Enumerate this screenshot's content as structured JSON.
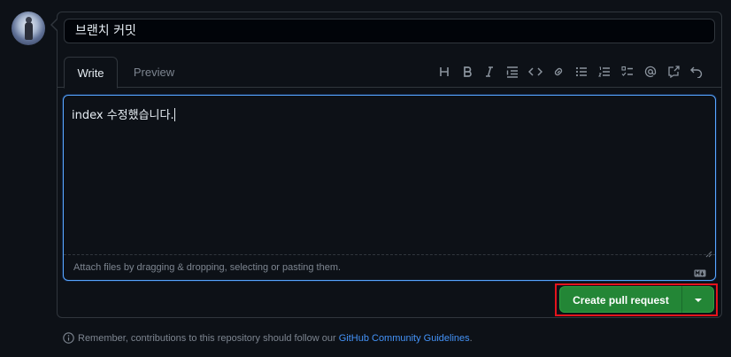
{
  "title_input": {
    "value": "브랜치 커밋"
  },
  "tabs": [
    {
      "label": "Write",
      "active": true
    },
    {
      "label": "Preview",
      "active": false
    }
  ],
  "toolbar": {
    "heading_label": "H",
    "bold_label": "B",
    "italic_label": "I",
    "icons": [
      "heading-icon",
      "bold-icon",
      "italic-icon",
      "quote-icon",
      "code-icon",
      "link-icon",
      "unordered-list-icon",
      "ordered-list-icon",
      "task-list-icon",
      "mention-icon",
      "reference-icon",
      "undo-icon"
    ]
  },
  "editor": {
    "value": "index 수정했습니다.",
    "attach_hint": "Attach files by dragging & dropping, selecting or pasting them."
  },
  "actions": {
    "create_pr_label": "Create pull request",
    "button_color": "#238636",
    "highlight_color": "#e5141c"
  },
  "footer": {
    "prefix": "Remember, contributions to this repository should follow our ",
    "link": "GitHub Community Guidelines",
    "suffix": "."
  }
}
